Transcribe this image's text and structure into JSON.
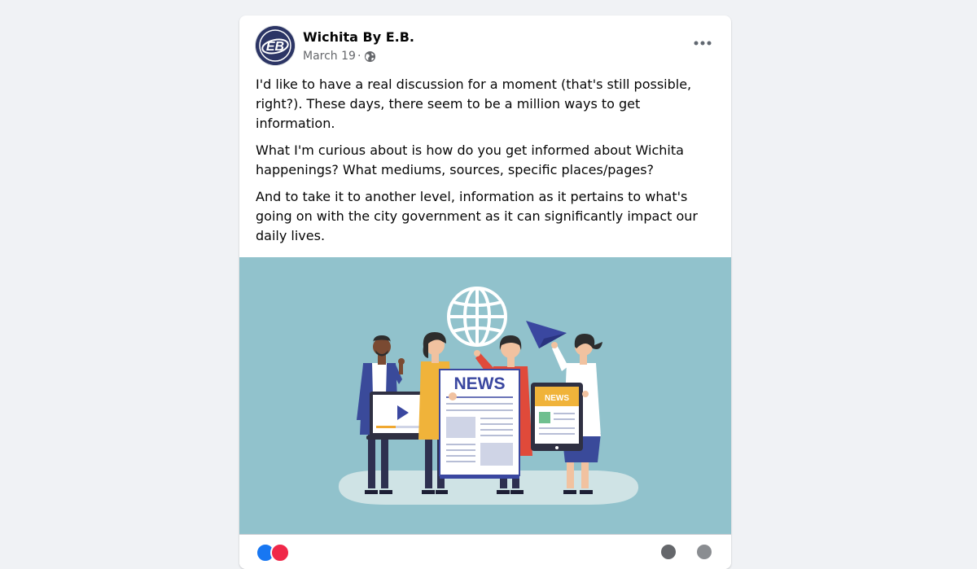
{
  "post": {
    "author_name": "Wichita By E.B.",
    "date": "March 19",
    "separator": "·",
    "audience_icon": "globe-icon",
    "avatar_initials": "EB",
    "more_icon": "more-options-icon",
    "paragraphs": [
      "I'd like to have a real discussion for a moment (that's still possible, right?).  These days, there seem to be a million ways to get information.",
      "What I'm curious about is how do you get informed about Wichita happenings? What mediums, sources, specific places/pages?",
      "And to take it to another level, information as it pertains to what's going on with the city government as it can significantly impact our daily lives."
    ]
  },
  "illustration": {
    "news_headline": "NEWS",
    "tablet_headline": "NEWS",
    "background_color": "#91c2cc"
  },
  "colors": {
    "accent_blue": "#1877f2",
    "reaction_red": "#f02849",
    "text_primary": "#050505",
    "text_secondary": "#65676b"
  },
  "reactions": [
    "like-reaction-icon",
    "love-reaction-icon"
  ]
}
